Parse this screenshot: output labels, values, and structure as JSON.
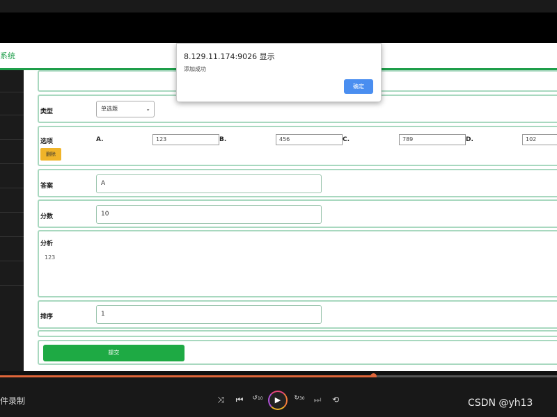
{
  "app": {
    "title": "系统"
  },
  "form": {
    "type": {
      "label": "类型",
      "value": "单选题"
    },
    "options": {
      "label": "选项",
      "items": [
        {
          "letter": "A.",
          "value": "123"
        },
        {
          "letter": "B.",
          "value": "456"
        },
        {
          "letter": "C.",
          "value": "789"
        },
        {
          "letter": "D.",
          "value": "102"
        }
      ],
      "delete_label": "删除"
    },
    "answer": {
      "label": "答案",
      "value": "A"
    },
    "score": {
      "label": "分数",
      "value": "10"
    },
    "analysis": {
      "label": "分析",
      "value": "123"
    },
    "order": {
      "label": "排序",
      "value": "1"
    },
    "submit_label": "提交"
  },
  "dialog": {
    "title": "8.129.11.174:9026 显示",
    "message": "添加成功",
    "ok_label": "确定"
  },
  "player": {
    "record_label": "件录制",
    "progress": 0.67,
    "skip_back_label": "10",
    "skip_forward_label": "30",
    "icons": [
      "shuffle-icon",
      "previous-icon",
      "rewind-10-icon",
      "play-icon",
      "forward-30-icon",
      "next-icon",
      "loop-icon"
    ]
  },
  "watermark": "CSDN @yh13",
  "colors": {
    "accent": "#1e9e4a",
    "panel_border": "#a8d8bf",
    "delete": "#f0b429",
    "submit": "#1eaa44",
    "dialog_ok": "#4a8ef0",
    "progress": "#e0663a"
  }
}
